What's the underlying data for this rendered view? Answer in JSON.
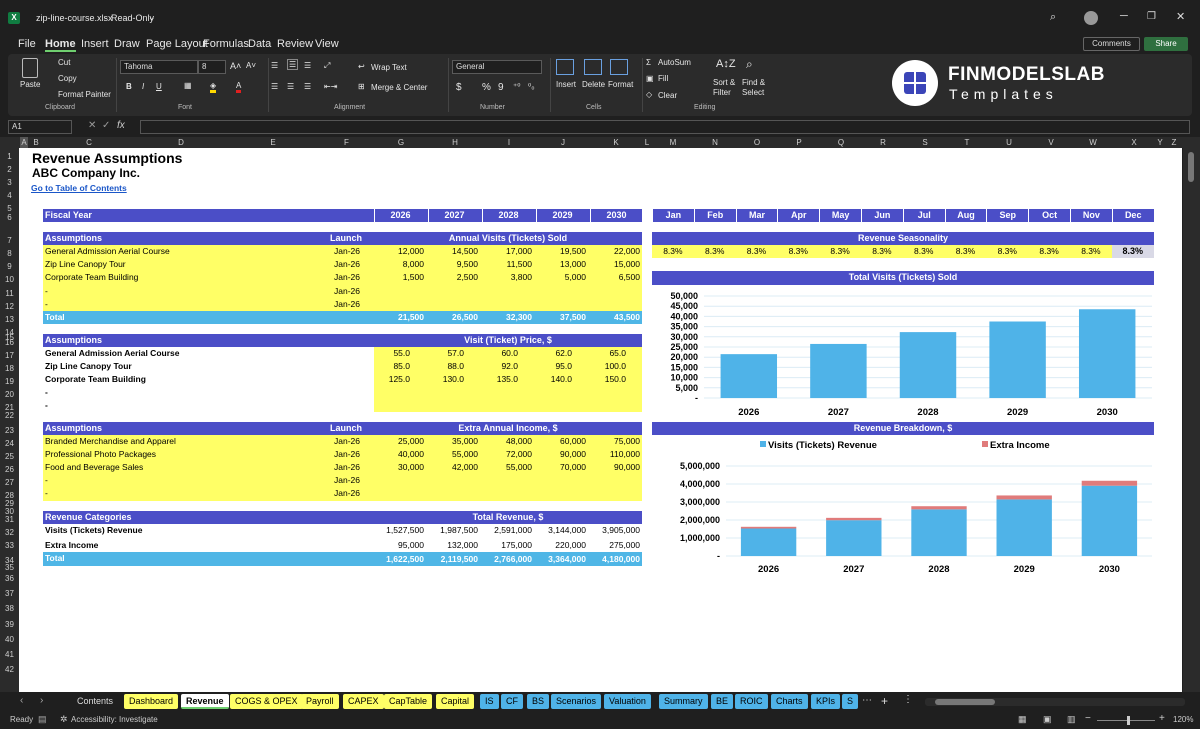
{
  "window": {
    "filename": "zip-line-course.xlsx",
    "mode": "Read-Only",
    "excel_icon": "excel-icon"
  },
  "menu": [
    "File",
    "Home",
    "Insert",
    "Draw",
    "Page Layout",
    "Formulas",
    "Data",
    "Review",
    "View"
  ],
  "header_buttons": {
    "comments": "Comments",
    "share": "Share"
  },
  "ribbon": {
    "clipboard": {
      "paste": "Paste",
      "cut": "Cut",
      "copy": "Copy",
      "format_painter": "Format Painter",
      "label": "Clipboard"
    },
    "font": {
      "name": "Tahoma",
      "size": "8",
      "label": "Font",
      "bold": "B",
      "italic": "I",
      "underline": "U"
    },
    "alignment": {
      "wrap": "Wrap Text",
      "merge": "Merge & Center",
      "label": "Alignment"
    },
    "number": {
      "format": "General",
      "label": "Number",
      "currency": "$",
      "percent": "%",
      "comma": "9"
    },
    "cells": {
      "insert": "Insert",
      "delete": "Delete",
      "format": "Format",
      "label": "Cells"
    },
    "editing": {
      "autosum": "AutoSum",
      "fill": "Fill",
      "clear": "Clear",
      "sort": "Sort &",
      "sort2": "Filter",
      "find": "Find &",
      "find2": "Select",
      "label": "Editing"
    }
  },
  "brand": {
    "name": "FINMODELSLAB",
    "tagline": "Templates"
  },
  "namebox": "A1",
  "columns": [
    "A",
    "B",
    "C",
    "D",
    "E",
    "F",
    "G",
    "H",
    "I",
    "J",
    "K",
    "L",
    "M",
    "N",
    "O",
    "P",
    "Q",
    "R",
    "S",
    "T",
    "U",
    "V",
    "W",
    "X",
    "Y",
    "Z"
  ],
  "rows": [
    "1",
    "2",
    "3",
    "4",
    "5",
    "6",
    "7",
    "8",
    "9",
    "10",
    "11",
    "12",
    "13",
    "14",
    "15",
    "16",
    "17",
    "18",
    "19",
    "20",
    "21",
    "22",
    "23",
    "24",
    "25",
    "26",
    "27",
    "28",
    "29",
    "30",
    "31",
    "32",
    "33",
    "34",
    "35",
    "36",
    "37",
    "38",
    "39",
    "40",
    "41",
    "42"
  ],
  "sheet": {
    "title": "Revenue Assumptions",
    "company": "ABC Company Inc.",
    "toc_link": "Go to Table of Contents",
    "fiscal_year_label": "Fiscal Year",
    "years": [
      "2026",
      "2027",
      "2028",
      "2029",
      "2030"
    ],
    "months": [
      "Jan",
      "Feb",
      "Mar",
      "Apr",
      "May",
      "Jun",
      "Jul",
      "Aug",
      "Sep",
      "Oct",
      "Nov",
      "Dec"
    ],
    "visits": {
      "assump": "Assumptions",
      "launch": "Launch",
      "header": "Annual Visits (Tickets) Sold",
      "rows": [
        {
          "name": "General Admission Aerial Course",
          "launch": "Jan-26",
          "vals": [
            "12,000",
            "14,500",
            "17,000",
            "19,500",
            "22,000"
          ]
        },
        {
          "name": "Zip Line Canopy Tour",
          "launch": "Jan-26",
          "vals": [
            "8,000",
            "9,500",
            "11,500",
            "13,000",
            "15,000"
          ]
        },
        {
          "name": "Corporate Team Building",
          "launch": "Jan-26",
          "vals": [
            "1,500",
            "2,500",
            "3,800",
            "5,000",
            "6,500"
          ]
        },
        {
          "name": "-",
          "launch": "Jan-26",
          "vals": [
            "",
            "",
            "",
            "",
            ""
          ]
        },
        {
          "name": "-",
          "launch": "Jan-26",
          "vals": [
            "",
            "",
            "",
            "",
            ""
          ]
        }
      ],
      "total_label": "Total",
      "totals": [
        "21,500",
        "26,500",
        "32,300",
        "37,500",
        "43,500"
      ]
    },
    "price": {
      "assump": "Assumptions",
      "header": "Visit (Ticket) Price, $",
      "rows": [
        {
          "name": "General Admission Aerial Course",
          "vals": [
            "55.0",
            "57.0",
            "60.0",
            "62.0",
            "65.0"
          ]
        },
        {
          "name": "Zip Line Canopy Tour",
          "vals": [
            "85.0",
            "88.0",
            "92.0",
            "95.0",
            "100.0"
          ]
        },
        {
          "name": "Corporate Team Building",
          "vals": [
            "125.0",
            "130.0",
            "135.0",
            "140.0",
            "150.0"
          ]
        },
        {
          "name": "-",
          "vals": [
            "",
            "",
            "",
            "",
            ""
          ]
        },
        {
          "name": "-",
          "vals": [
            "",
            "",
            "",
            "",
            ""
          ]
        }
      ]
    },
    "extra": {
      "assump": "Assumptions",
      "launch": "Launch",
      "header": "Extra Annual Income, $",
      "rows": [
        {
          "name": "Branded Merchandise and Apparel",
          "launch": "Jan-26",
          "vals": [
            "25,000",
            "35,000",
            "48,000",
            "60,000",
            "75,000"
          ]
        },
        {
          "name": "Professional Photo Packages",
          "launch": "Jan-26",
          "vals": [
            "40,000",
            "55,000",
            "72,000",
            "90,000",
            "110,000"
          ]
        },
        {
          "name": "Food and Beverage Sales",
          "launch": "Jan-26",
          "vals": [
            "30,000",
            "42,000",
            "55,000",
            "70,000",
            "90,000"
          ]
        },
        {
          "name": "-",
          "launch": "Jan-26",
          "vals": [
            "",
            "",
            "",
            "",
            ""
          ]
        },
        {
          "name": "-",
          "launch": "Jan-26",
          "vals": [
            "",
            "",
            "",
            "",
            ""
          ]
        }
      ]
    },
    "revcat": {
      "label": "Revenue Categories",
      "header": "Total Revenue, $",
      "rows": [
        {
          "name": "Visits (Tickets) Revenue",
          "vals": [
            "1,527,500",
            "1,987,500",
            "2,591,000",
            "3,144,000",
            "3,905,000"
          ]
        },
        {
          "name": "Extra Income",
          "vals": [
            "95,000",
            "132,000",
            "175,000",
            "220,000",
            "275,000"
          ]
        }
      ],
      "total_label": "Total",
      "totals": [
        "1,622,500",
        "2,119,500",
        "2,766,000",
        "3,364,000",
        "4,180,000"
      ]
    },
    "seasonality": {
      "header": "Revenue Seasonality",
      "vals": [
        "8.3%",
        "8.3%",
        "8.3%",
        "8.3%",
        "8.3%",
        "8.3%",
        "8.3%",
        "8.3%",
        "8.3%",
        "8.3%",
        "8.3%",
        "8.3%"
      ]
    }
  },
  "chart_data": [
    {
      "type": "bar",
      "title": "Total Visits (Tickets) Sold",
      "categories": [
        "2026",
        "2027",
        "2028",
        "2029",
        "2030"
      ],
      "values": [
        21500,
        26500,
        32300,
        37500,
        43500
      ],
      "ylim": [
        0,
        50000
      ],
      "yticks": [
        "50,000",
        "45,000",
        "40,000",
        "35,000",
        "30,000",
        "25,000",
        "20,000",
        "15,000",
        "10,000",
        "5,000",
        "-"
      ],
      "color": "#4fb3e8"
    },
    {
      "type": "bar",
      "title": "Revenue Breakdown, $",
      "categories": [
        "2026",
        "2027",
        "2028",
        "2029",
        "2030"
      ],
      "series": [
        {
          "name": "Visits (Tickets) Revenue",
          "values": [
            1527500,
            1987500,
            2591000,
            3144000,
            3905000
          ],
          "color": "#4fb3e8"
        },
        {
          "name": "Extra Income",
          "values": [
            95000,
            132000,
            175000,
            220000,
            275000
          ],
          "color": "#e07b7b"
        }
      ],
      "ylim": [
        0,
        5000000
      ],
      "yticks": [
        "5,000,000",
        "4,000,000",
        "3,000,000",
        "2,000,000",
        "1,000,000",
        "-"
      ],
      "stacked": true
    }
  ],
  "tabs": [
    {
      "label": "Contents",
      "color": "#1f1f1f",
      "fg": "#ddd"
    },
    {
      "label": "Dashboard",
      "color": "#ffff66",
      "fg": "#000"
    },
    {
      "label": "Revenue",
      "color": "#ffffff",
      "fg": "#000"
    },
    {
      "label": "COGS & OPEX",
      "color": "#ffff66",
      "fg": "#000"
    },
    {
      "label": "Payroll",
      "color": "#ffff66",
      "fg": "#000"
    },
    {
      "label": "CAPEX",
      "color": "#ffff66",
      "fg": "#000"
    },
    {
      "label": "CapTable",
      "color": "#ffff66",
      "fg": "#000"
    },
    {
      "label": "Capital",
      "color": "#ffff66",
      "fg": "#000"
    },
    {
      "label": "IS",
      "color": "#4fb3e8",
      "fg": "#000"
    },
    {
      "label": "CF",
      "color": "#4fb3e8",
      "fg": "#000"
    },
    {
      "label": "BS",
      "color": "#4fb3e8",
      "fg": "#000"
    },
    {
      "label": "Scenarios",
      "color": "#4fb3e8",
      "fg": "#000"
    },
    {
      "label": "Valuation",
      "color": "#4fb3e8",
      "fg": "#000"
    },
    {
      "label": "Summary",
      "color": "#4fb3e8",
      "fg": "#000"
    },
    {
      "label": "BE",
      "color": "#4fb3e8",
      "fg": "#000"
    },
    {
      "label": "ROIC",
      "color": "#4fb3e8",
      "fg": "#000"
    },
    {
      "label": "Charts",
      "color": "#4fb3e8",
      "fg": "#000"
    },
    {
      "label": "KPIs",
      "color": "#4fb3e8",
      "fg": "#000"
    },
    {
      "label": "S",
      "color": "#4fb3e8",
      "fg": "#000"
    }
  ],
  "status": {
    "ready": "Ready",
    "accessibility": "Accessibility: Investigate",
    "zoom": "120%"
  }
}
